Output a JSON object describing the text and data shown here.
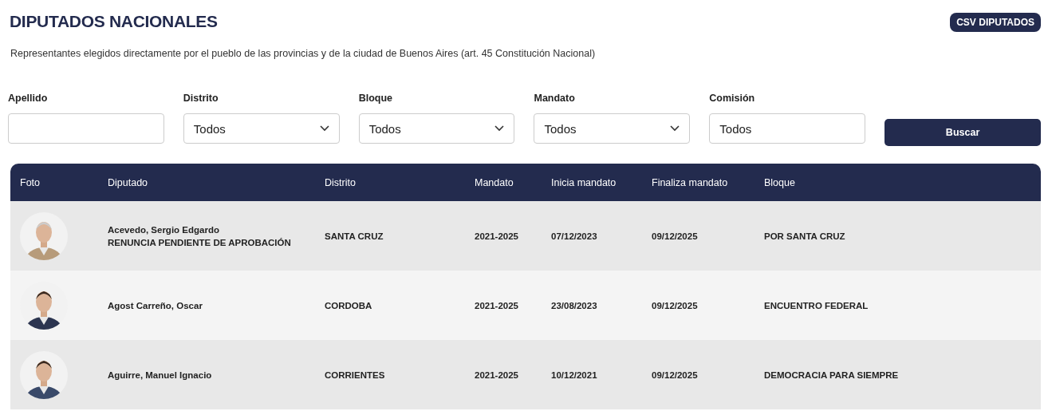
{
  "header": {
    "title": "DIPUTADOS NACIONALES",
    "export_button": "CSV DIPUTADOS",
    "subtitle": "Representantes elegidos directamente por el pueblo de las provincias y de la ciudad de Buenos Aires (art. 45 Constitución Nacional)"
  },
  "filters": [
    {
      "kind": "text",
      "label": "Apellido"
    },
    {
      "kind": "select",
      "label": "Distrito",
      "value": "Todos"
    },
    {
      "kind": "select",
      "label": "Bloque",
      "value": "Todos"
    },
    {
      "kind": "select",
      "label": "Mandato",
      "value": "Todos"
    },
    {
      "kind": "text",
      "label": "Comisión",
      "value": "Todos"
    }
  ],
  "search_button": "Buscar",
  "table": {
    "columns": [
      "Foto",
      "Diputado",
      "Distrito",
      "Mandato",
      "Inicia mandato",
      "Finaliza mandato",
      "Bloque"
    ],
    "rows": [
      {
        "name": "Acevedo, Sergio Edgardo",
        "note": "RENUNCIA PENDIENTE DE APROBACIÓN",
        "district": "SANTA CRUZ",
        "term": "2021-2025",
        "start": "07/12/2023",
        "end": "09/12/2025",
        "bloc": "POR SANTA CRUZ"
      },
      {
        "name": "Agost Carreño, Oscar",
        "district": "CORDOBA",
        "term": "2021-2025",
        "start": "23/08/2023",
        "end": "09/12/2025",
        "bloc": "ENCUENTRO FEDERAL"
      },
      {
        "name": "Aguirre, Manuel Ignacio",
        "district": "CORRIENTES",
        "term": "2021-2025",
        "start": "10/12/2021",
        "end": "09/12/2025",
        "bloc": "DEMOCRACIA PARA SIEMPRE"
      }
    ]
  }
}
